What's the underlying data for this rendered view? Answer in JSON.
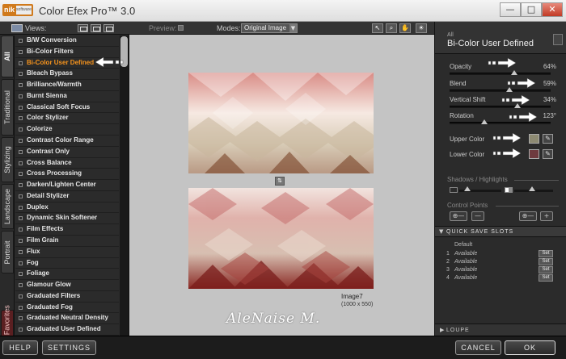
{
  "titlebar": {
    "logo_text": "nik",
    "logo_subtext": "software",
    "title": "Color Efex Pro™ 3.0",
    "minimize": "—",
    "maximize": "□",
    "close": "✕"
  },
  "left_panel": {
    "views_label": "Views:",
    "tabs": [
      {
        "label": "All",
        "active": true
      },
      {
        "label": "Traditional",
        "active": false
      },
      {
        "label": "Stylizing",
        "active": false
      },
      {
        "label": "Landscape",
        "active": false
      },
      {
        "label": "Portrait",
        "active": false
      },
      {
        "label": "★ Favorites",
        "active": false
      }
    ],
    "filters": [
      "B/W Conversion",
      "Bi-Color Filters",
      "Bi-Color User Defined",
      "Bleach Bypass",
      "Brilliance/Warmth",
      "Burnt Sienna",
      "Classical Soft Focus",
      "Color Stylizer",
      "Colorize",
      "Contrast Color Range",
      "Contrast Only",
      "Cross Balance",
      "Cross Processing",
      "Darken/Lighten Center",
      "Detail Stylizer",
      "Duplex",
      "Dynamic Skin Softener",
      "Film Effects",
      "Film Grain",
      "Flux",
      "Fog",
      "Foliage",
      "Glamour Glow",
      "Graduated Filters",
      "Graduated Fog",
      "Graduated Neutral Density",
      "Graduated User Defined"
    ],
    "selected_filter": "Bi-Color User Defined",
    "scroll_position": 0.0
  },
  "toolbar": {
    "preview_label": "Preview:",
    "modes_label": "Modes:",
    "modes_value": "Original Image",
    "modes_arrow": "▼",
    "tools": [
      "↖",
      "⌕",
      "✋",
      "☀"
    ]
  },
  "preview": {
    "swap_icon": "⇅",
    "image_name": "Image7",
    "image_size": "(1000 x 550)",
    "signature": "AleNaise M."
  },
  "right_panel": {
    "category": "All",
    "filter_title": "Bi-Color User Defined",
    "params": [
      {
        "label": "Opacity",
        "value": "64%",
        "level": 0.64
      },
      {
        "label": "Blend",
        "value": "59%",
        "level": 0.59
      },
      {
        "label": "Vertical Shift",
        "value": "34%",
        "level": 0.67
      },
      {
        "label": "Rotation",
        "value": "123°",
        "level": 0.34
      }
    ],
    "colors": [
      {
        "label": "Upper Color",
        "swatch": "#8d8a72",
        "picker": "✎"
      },
      {
        "label": "Lower Color",
        "swatch": "#6e3a3e",
        "picker": "✎"
      }
    ],
    "shadows_highlights_label": "Shadows / Highlights",
    "shadows_level": 0.2,
    "highlights_level": 0.45,
    "control_points_label": "Control Points",
    "cp_add": "⊕—",
    "cp_remove": "—",
    "cp_add_right": "⊕—",
    "cp_plus": "+",
    "quick_save": {
      "arrow": "▼",
      "title": "QUICK SAVE SLOTS",
      "default_label": "Default",
      "slots": [
        {
          "num": "1",
          "status": "Available",
          "set": "Set"
        },
        {
          "num": "2",
          "status": "Available",
          "set": "Set"
        },
        {
          "num": "3",
          "status": "Available",
          "set": "Set"
        },
        {
          "num": "4",
          "status": "Available",
          "set": "Set"
        }
      ]
    },
    "loupe": {
      "arrow": "▶",
      "title": "LOUPE"
    }
  },
  "bottom_bar": {
    "help": "HELP",
    "settings": "SETTINGS",
    "cancel": "CANCEL",
    "ok": "OK"
  }
}
